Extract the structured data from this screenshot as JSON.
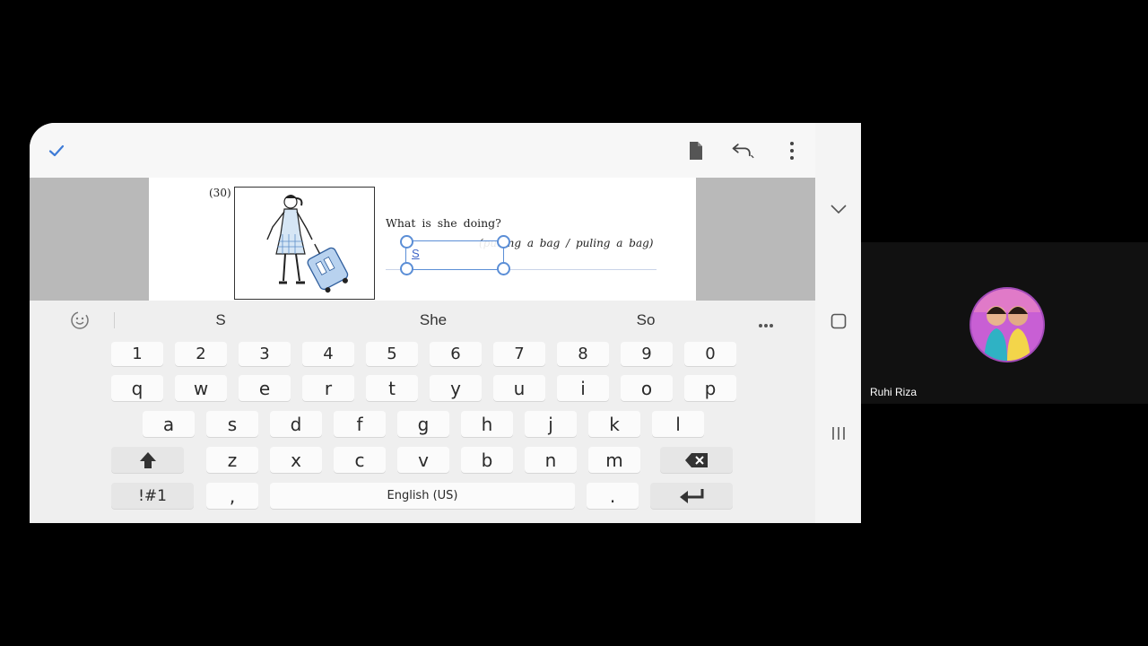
{
  "document": {
    "question_number": "(30)",
    "question": "What is she doing?",
    "options": "(pulling a bag / puling a bag)",
    "answer_text": "S"
  },
  "keyboard": {
    "suggestions": [
      "S",
      "She",
      "So"
    ],
    "number_row": [
      "1",
      "2",
      "3",
      "4",
      "5",
      "6",
      "7",
      "8",
      "9",
      "0"
    ],
    "row1": [
      "q",
      "w",
      "e",
      "r",
      "t",
      "y",
      "u",
      "i",
      "o",
      "p"
    ],
    "row2": [
      "a",
      "s",
      "d",
      "f",
      "g",
      "h",
      "j",
      "k",
      "l"
    ],
    "row3": [
      "z",
      "x",
      "c",
      "v",
      "b",
      "n",
      "m"
    ],
    "symbols_label": "!#1",
    "comma": ",",
    "space_label": "English (US)",
    "period": "."
  },
  "participant": {
    "name": "Ruhi Riza"
  },
  "colors": {
    "accent": "#3e7bd6",
    "selection": "#5b8ed6"
  }
}
